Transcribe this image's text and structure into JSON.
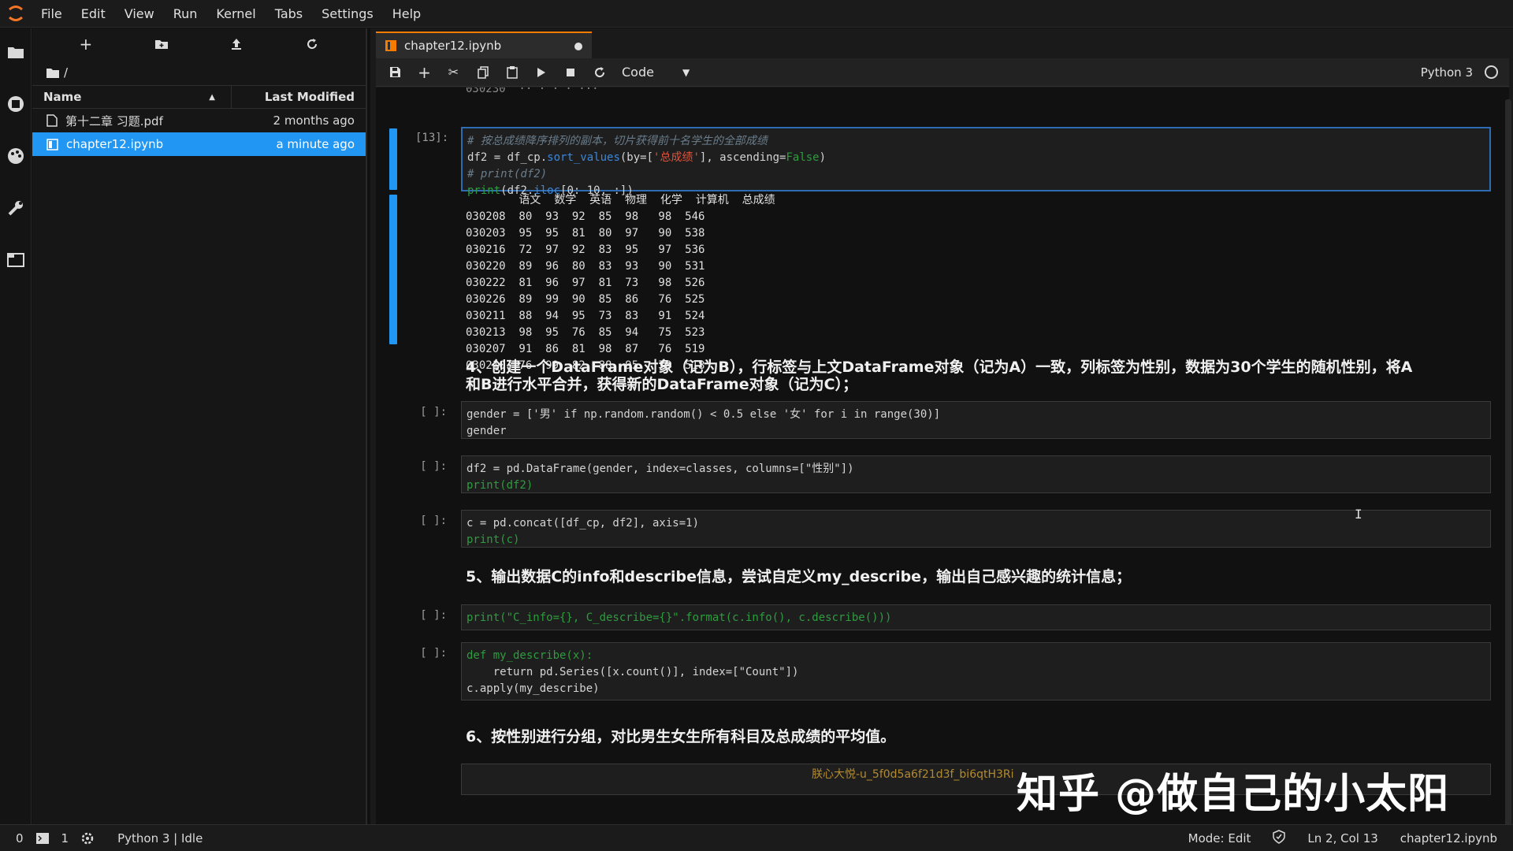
{
  "menu": [
    "File",
    "Edit",
    "View",
    "Run",
    "Kernel",
    "Tabs",
    "Settings",
    "Help"
  ],
  "filebrowser": {
    "path": "/",
    "header_name": "Name",
    "header_modified": "Last Modified",
    "files": [
      {
        "name": "第十二章 习题.pdf",
        "modified": "2 months ago",
        "icon": "file-icon"
      },
      {
        "name": "chapter12.ipynb",
        "modified": "a minute ago",
        "icon": "notebook-icon",
        "selected": true
      }
    ]
  },
  "tab": {
    "title": "chapter12.ipynb"
  },
  "toolbar": {
    "cell_type": "Code",
    "kernel": "Python 3"
  },
  "cells": {
    "c13": {
      "prompt": "[13]:",
      "line1": "# 按总成绩降序排列的副本，切片获得前十名学生的全部成绩",
      "line2a": "df2 = df_cp.",
      "line2b": "sort_values",
      "line2c": "(by=[",
      "line2d": "'总成绩'",
      "line2e": "], ascending=",
      "line2f": "False",
      "line2g": ")",
      "line3": "# print(df2)",
      "line4a": "print",
      "line4b": "(df2.",
      "line4c": "iloc",
      "line4d": "[0: 10, :])"
    },
    "output13": {
      "header": "        语文  数学  英语  物理  化学  计算机  总成绩",
      "rows": [
        "030208  80  93  92  85  98   98  546",
        "030203  95  95  81  80  97   90  538",
        "030216  72  97  92  83  95   97  536",
        "030220  89  96  80  83  93   90  531",
        "030222  81  96  97  81  73   98  526",
        "030226  89  99  90  85  86   76  525",
        "030211  88  94  95  73  83   91  524",
        "030213  98  95  76  85  94   75  523",
        "030207  91  86  81  98  87   76  519",
        "030210  76  99  82  88  95   78  518"
      ]
    },
    "md4_line1": "4、创建一个DataFrame对象（记为B），行标签与上文DataFrame对象（记为A）一致，列标签为性别，数据为30个学生的随机性别，将A",
    "md4_line2": "和B进行水平合并，获得新的DataFrame对象（记为C）；",
    "c_gender": {
      "prompt": "[ ]:",
      "line1": "gender = ['男' if np.random.random() < 0.5 else '女' for i in range(30)]",
      "line2": "gender"
    },
    "c_df2": {
      "prompt": "[ ]:",
      "line1": "df2 = pd.DataFrame(gender, index=classes, columns=[\"性别\"])",
      "line2": "print(df2)"
    },
    "c_concat": {
      "prompt": "[ ]:",
      "line1": "c = pd.concat([df_cp, df2], axis=1)",
      "line2": "print(c)"
    },
    "md5": "5、输出数据C的info和describe信息，尝试自定义my_describe，输出自己感兴趣的统计信息；",
    "c_info": {
      "prompt": "[ ]:",
      "line1": "print(\"C_info={}, C_describe={}\".format(c.info(), c.describe()))"
    },
    "c_mydesc": {
      "prompt": "[ ]:",
      "line1": "def my_describe(x):",
      "line2": "    return pd.Series([x.count()], index=[\"Count\"])",
      "line3": "c.apply(my_describe)"
    },
    "md6": "6、按性别进行分组，对比男生女生所有科目及总成绩的平均值。"
  },
  "watermark": {
    "main": "知乎 @做自己的小太阳",
    "small": "朕心大悦-u_5f0d5a6f21d3f_bi6qtH3Ri"
  },
  "statusbar": {
    "left_count1": "0",
    "left_count2": "1",
    "kernel_state": "Python 3 | Idle",
    "mode": "Mode: Edit",
    "position": "Ln 2, Col 13",
    "filename": "chapter12.ipynb"
  },
  "colors": {
    "accent": "#2196f3",
    "tab_accent": "#f57c00",
    "string": "#e0533b",
    "keyword": "#2e9c3f",
    "function": "#3e86d6"
  }
}
